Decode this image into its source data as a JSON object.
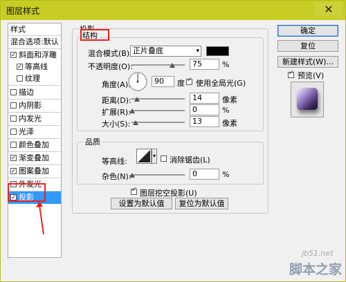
{
  "window": {
    "title": "图层样式",
    "close_glyph": "✕"
  },
  "left_panel": {
    "items": [
      {
        "label": "样式",
        "checkbox": false
      },
      {
        "label": "混合选项:默认",
        "checkbox": false
      },
      {
        "label": "斜面和浮雕",
        "checkbox": true,
        "checked": true
      },
      {
        "label": "等高线",
        "checkbox": true,
        "checked": true
      },
      {
        "label": "纹理",
        "checkbox": true,
        "checked": false
      },
      {
        "label": "描边",
        "checkbox": true,
        "checked": false
      },
      {
        "label": "内阴影",
        "checkbox": true,
        "checked": false
      },
      {
        "label": "内发光",
        "checkbox": true,
        "checked": false
      },
      {
        "label": "光泽",
        "checkbox": true,
        "checked": false
      },
      {
        "label": "颜色叠加",
        "checkbox": true,
        "checked": false
      },
      {
        "label": "渐变叠加",
        "checkbox": true,
        "checked": true
      },
      {
        "label": "图案叠加",
        "checkbox": true,
        "checked": true
      },
      {
        "label": "外发光",
        "checkbox": true,
        "checked": false
      },
      {
        "label": "投影",
        "checkbox": true,
        "checked": true,
        "selected": true
      }
    ]
  },
  "shadow": {
    "group_title": "投影",
    "structure_title": "结构",
    "blend_mode_label": "混合模式(B):",
    "blend_mode_value": "正片叠底",
    "blend_color": "#000000",
    "opacity_label": "不透明度(O):",
    "opacity_value": "75",
    "opacity_fraction": 0.75,
    "opacity_unit": "%",
    "angle_label": "角度(A):",
    "angle_value": "90",
    "angle_unit": "度",
    "global_light_label": "使用全局光(G)",
    "global_light_checked": true,
    "distance_label": "距离(D):",
    "distance_value": "14",
    "distance_unit": "像素",
    "spread_label": "扩展(R):",
    "spread_value": "0",
    "spread_unit": "%",
    "size_label": "大小(S):",
    "size_value": "13",
    "size_unit": "像素"
  },
  "quality": {
    "title": "品质",
    "contour_label": "等高线:",
    "antialias_label": "消除锯齿(L)",
    "antialias_checked": false,
    "noise_label": "杂色(N):",
    "noise_value": "0",
    "noise_unit": "%"
  },
  "knockout_label": "图层挖空投影(U)",
  "knockout_checked": true,
  "set_default_label": "设置为默认值",
  "reset_default_label": "复位为默认值",
  "buttons": {
    "ok": "确定",
    "reset": "复位",
    "new_style": "新建样式(W)...",
    "preview": "预览(V)",
    "preview_checked": true
  },
  "watermark": {
    "site": "jb51.net",
    "brand": "脚本之家"
  },
  "colors": {
    "title_bar": "#c8cd26",
    "selection": "#3399ff",
    "annotation": "#e8221a"
  }
}
